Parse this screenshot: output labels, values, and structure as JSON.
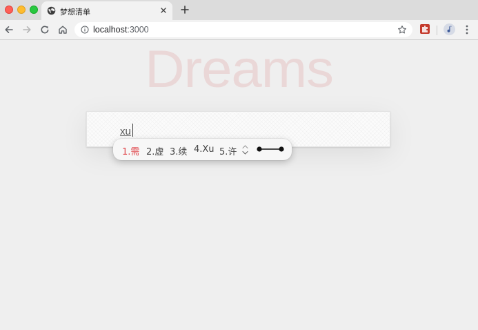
{
  "browser": {
    "tab_title": "梦想清单",
    "url_host": "localhost",
    "url_port": ":3000",
    "controls": {
      "back": "arrow-left-icon",
      "forward": "arrow-right-icon",
      "reload": "reload-icon",
      "home": "home-icon",
      "info": "info-icon",
      "bookmark": "star-icon",
      "extension": "extension-icon",
      "profile": "avatar-icon",
      "menu": "more-vert-icon"
    }
  },
  "page": {
    "title": "Dreams",
    "input_value": "xu"
  },
  "ime": {
    "candidates": [
      {
        "label": "1.需",
        "active": true
      },
      {
        "label": "2.虚",
        "active": false
      },
      {
        "label": "3.续",
        "active": false
      },
      {
        "label": "4.Xu",
        "active": false
      },
      {
        "label": "5.许",
        "active": false
      }
    ],
    "pager": "chevron-up-down-icon",
    "toggle": "candidate-layout-toggle-icon"
  },
  "colors": {
    "page_background": "#efefef",
    "title_color": "#ead7d7",
    "active_candidate": "#e0484d"
  }
}
